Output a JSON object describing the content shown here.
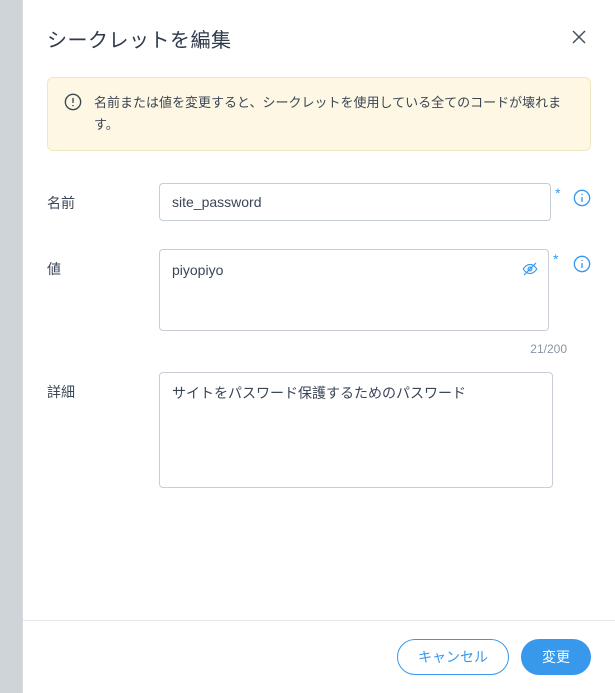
{
  "dialog": {
    "title": "シークレットを編集",
    "warning": "名前または値を変更すると、シークレットを使用している全てのコードが壊れます。"
  },
  "form": {
    "name": {
      "label": "名前",
      "value": "site_password"
    },
    "value": {
      "label": "値",
      "value": "piyopiyo",
      "counter": "21/200"
    },
    "detail": {
      "label": "詳細",
      "value": "サイトをパスワード保護するためのパスワード"
    }
  },
  "footer": {
    "cancel": "キャンセル",
    "submit": "変更"
  }
}
